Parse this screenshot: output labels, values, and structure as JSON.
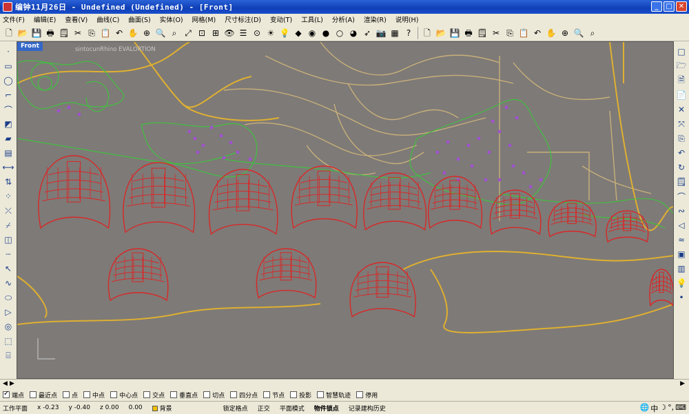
{
  "window": {
    "title": "编钟11月26日 - Undefined (Undefined) - [Front]",
    "min_label": "_",
    "max_label": "□",
    "close_label": "✕"
  },
  "menu": [
    "文件(F)",
    "编辑(E)",
    "查看(V)",
    "曲线(C)",
    "曲面(S)",
    "实体(O)",
    "网格(M)",
    "尺寸标注(D)",
    "变动(T)",
    "工具(L)",
    "分析(A)",
    "渲染(R)",
    "说明(H)"
  ],
  "toolbar_icons": [
    {
      "name": "new-icon",
      "glyph": "🗋"
    },
    {
      "name": "open-icon",
      "glyph": "📂"
    },
    {
      "name": "save-icon",
      "glyph": "💾"
    },
    {
      "name": "print-icon",
      "glyph": "🖶"
    },
    {
      "name": "properties-icon",
      "glyph": "🗒"
    },
    {
      "name": "cut-icon",
      "glyph": "✂"
    },
    {
      "name": "copy-icon",
      "glyph": "⎘"
    },
    {
      "name": "paste-icon",
      "glyph": "📋"
    },
    {
      "name": "undo-icon",
      "glyph": "↶"
    },
    {
      "name": "pan-icon",
      "glyph": "✋"
    },
    {
      "name": "rotate-view-icon",
      "glyph": "⊕"
    },
    {
      "name": "zoom-icon",
      "glyph": "🔍"
    },
    {
      "name": "zoom-window-icon",
      "glyph": "⌕"
    },
    {
      "name": "zoom-extents-icon",
      "glyph": "⤢"
    },
    {
      "name": "zoom-selected-icon",
      "glyph": "⊡"
    },
    {
      "name": "four-viewports-icon",
      "glyph": "⊞"
    },
    {
      "name": "hide-icon",
      "glyph": "👁"
    },
    {
      "name": "layer-icon",
      "glyph": "☰"
    },
    {
      "name": "snap-icon",
      "glyph": "⊙"
    },
    {
      "name": "sun-icon",
      "glyph": "☀"
    },
    {
      "name": "light-icon",
      "glyph": "💡"
    },
    {
      "name": "render-icon",
      "glyph": "◆"
    },
    {
      "name": "material-icon",
      "glyph": "◉"
    },
    {
      "name": "color-wheel-icon",
      "glyph": "●"
    },
    {
      "name": "sphere-icon",
      "glyph": "○"
    },
    {
      "name": "shaded-sphere-icon",
      "glyph": "◕"
    },
    {
      "name": "pointer-icon",
      "glyph": "➶"
    },
    {
      "name": "camera-icon",
      "glyph": "📷"
    },
    {
      "name": "grid-icon",
      "glyph": "▦"
    },
    {
      "name": "help-icon",
      "glyph": "?"
    },
    {
      "name": "new-icon-2",
      "glyph": "🗋"
    },
    {
      "name": "open-icon-2",
      "glyph": "📂"
    },
    {
      "name": "save-icon-2",
      "glyph": "💾"
    },
    {
      "name": "print-icon-2",
      "glyph": "🖶"
    },
    {
      "name": "properties-icon-2",
      "glyph": "🗒"
    },
    {
      "name": "cut-icon-2",
      "glyph": "✂"
    },
    {
      "name": "copy-icon-2",
      "glyph": "⎘"
    },
    {
      "name": "paste-icon-2",
      "glyph": "📋"
    },
    {
      "name": "undo-icon-2",
      "glyph": "↶"
    },
    {
      "name": "pan-icon-2",
      "glyph": "✋"
    },
    {
      "name": "rotate-view-icon-2",
      "glyph": "⊕"
    },
    {
      "name": "zoom-icon-2",
      "glyph": "🔍"
    },
    {
      "name": "zoom-window-icon-2",
      "glyph": "⌕"
    }
  ],
  "left_tools": [
    {
      "name": "point-tool-icon",
      "glyph": "·"
    },
    {
      "name": "rectangle-tool-icon",
      "glyph": "▭"
    },
    {
      "name": "circle-tool-icon",
      "glyph": "◯"
    },
    {
      "name": "polyline-tool-icon",
      "glyph": "⌐"
    },
    {
      "name": "arc-tool-icon",
      "glyph": "⌒"
    },
    {
      "name": "surface-tool-icon",
      "glyph": "◩"
    },
    {
      "name": "solid-tool-icon",
      "glyph": "▰"
    },
    {
      "name": "mesh-tool-icon",
      "glyph": "▤"
    },
    {
      "name": "dimension-tool-icon",
      "glyph": "⟷"
    },
    {
      "name": "transform-tool-icon",
      "glyph": "⇅"
    },
    {
      "name": "array-tool-icon",
      "glyph": "⁘"
    },
    {
      "name": "trim-tool-icon",
      "glyph": "⤫"
    },
    {
      "name": "split-tool-icon",
      "glyph": "⌿"
    },
    {
      "name": "group-tool-icon",
      "glyph": "◫"
    },
    {
      "name": "ruler-tool-icon",
      "glyph": "┄"
    },
    {
      "name": "select-tool-icon",
      "glyph": "↖"
    },
    {
      "name": "curve-tool-icon",
      "glyph": "∿"
    },
    {
      "name": "ellipse-tool-icon",
      "glyph": "⬭"
    },
    {
      "name": "triangle-tool-icon",
      "glyph": "▷"
    },
    {
      "name": "torus-tool-icon",
      "glyph": "◎"
    },
    {
      "name": "box-tool-icon",
      "glyph": "⬚"
    },
    {
      "name": "cylinder-tool-icon",
      "glyph": "⌸"
    }
  ],
  "right_tools": [
    {
      "name": "box-view-icon",
      "glyph": "□"
    },
    {
      "name": "open-file-icon",
      "glyph": "🗁"
    },
    {
      "name": "note-icon",
      "glyph": "🗎"
    },
    {
      "name": "page-icon",
      "glyph": "📄"
    },
    {
      "name": "cross-icon",
      "glyph": "✕"
    },
    {
      "name": "explode-icon",
      "glyph": "⤧"
    },
    {
      "name": "copy-object-icon",
      "glyph": "⎘"
    },
    {
      "name": "undo-object-icon",
      "glyph": "↶"
    },
    {
      "name": "sweep-icon",
      "glyph": "↻"
    },
    {
      "name": "properties-page-icon",
      "glyph": "🗒"
    },
    {
      "name": "bend-icon",
      "glyph": "⌒"
    },
    {
      "name": "twist-icon",
      "glyph": "∾"
    },
    {
      "name": "taper-icon",
      "glyph": "◁"
    },
    {
      "name": "flow-icon",
      "glyph": "≈"
    },
    {
      "name": "cage-icon",
      "glyph": "▣"
    },
    {
      "name": "color-palette-icon",
      "glyph": "▥"
    },
    {
      "name": "light-bulb-icon",
      "glyph": "💡"
    },
    {
      "name": "dot-icon",
      "glyph": "•"
    }
  ],
  "viewport": {
    "tab_label": "Front",
    "watermark": "sintocunRhino EVALORTION"
  },
  "osnaps": [
    {
      "label": "端点",
      "checked": true
    },
    {
      "label": "最近点",
      "checked": false
    },
    {
      "label": "点",
      "checked": false
    },
    {
      "label": "中点",
      "checked": false
    },
    {
      "label": "中心点",
      "checked": false
    },
    {
      "label": "交点",
      "checked": false
    },
    {
      "label": "垂直点",
      "checked": false
    },
    {
      "label": "切点",
      "checked": false
    },
    {
      "label": "四分点",
      "checked": false
    },
    {
      "label": "节点",
      "checked": false
    },
    {
      "label": "投影",
      "checked": false
    },
    {
      "label": "智慧轨迹",
      "checked": false
    },
    {
      "label": "停用",
      "checked": false
    }
  ],
  "status": {
    "cplane": "工作平面",
    "x": "x -0.23",
    "y": "y -0.40",
    "z": "z 0.00",
    "delta": "0.00",
    "layer": "背景",
    "grid_snap": "锁定格点",
    "ortho": "正交",
    "planar": "平面模式",
    "osnap": "物件锁点",
    "history": "记录建构历史"
  },
  "colors": {
    "viewport_bg": "#7e7a77",
    "contour_yellow": "#e0b030",
    "contour_tan": "#c8b07a",
    "vegetation_green": "#40c040",
    "flower_purple": "#a050d0",
    "bell_red": "#d82828"
  }
}
